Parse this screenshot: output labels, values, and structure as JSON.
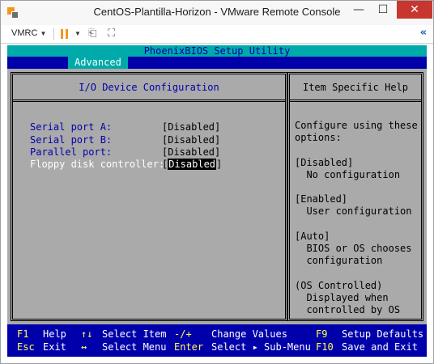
{
  "window": {
    "title": "CentOS-Plantilla-Horizon - VMware Remote Console",
    "minimize": "—",
    "maximize": "☐",
    "close": "✕"
  },
  "toolbar": {
    "menu_label": "VMRC",
    "menu_caret": "▼",
    "pause_caret": "▼",
    "collapse_glyph": "«"
  },
  "colors": {
    "bios_bg": "#0000aa",
    "bios_fg": "#ffffff",
    "title_bar_bg": "#00aaaa",
    "panel_bg": "#aaaaaa",
    "setting_label": "#0000aa",
    "highlight_bg": "#000000",
    "footer_key": "#ffff55",
    "footer_text": "#ffffff",
    "close_bg": "#c7372f",
    "accent_orange": "#f7941d"
  },
  "bios": {
    "title": "PhoenixBIOS Setup Utility",
    "active_tab": "Advanced",
    "left_header": "I/O Device Configuration",
    "right_header": "Item Specific Help",
    "settings": [
      {
        "label": "Serial port A:",
        "value": "[Disabled]"
      },
      {
        "label": "Serial port B:",
        "value": "[Disabled]"
      },
      {
        "label": "Parallel port:",
        "value": "[Disabled]"
      },
      {
        "label": "Floppy disk controller:",
        "value_open": "[",
        "value_hl": "Disabled",
        "value_close": "]"
      }
    ],
    "help_lines": [
      "Configure using these",
      "options:",
      "",
      "[Disabled]",
      "  No configuration",
      "",
      "[Enabled]",
      "  User configuration",
      "",
      "[Auto]",
      "  BIOS or OS chooses",
      "  configuration",
      "",
      "(OS Controlled)",
      "  Displayed when",
      "  controlled by OS"
    ],
    "footer": {
      "row1": [
        {
          "key": "F1",
          "label": "Help"
        },
        {
          "key": "↑↓",
          "label": "Select Item"
        },
        {
          "key": "-/+",
          "label": "Change Values"
        },
        {
          "key": "F9",
          "label": "Setup Defaults"
        }
      ],
      "row2": [
        {
          "key": "Esc",
          "label": "Exit"
        },
        {
          "key": "↔",
          "label": "Select Menu"
        },
        {
          "key": "Enter",
          "label": "Select ▸ Sub-Menu"
        },
        {
          "key": "F10",
          "label": "Save and Exit"
        }
      ]
    }
  }
}
